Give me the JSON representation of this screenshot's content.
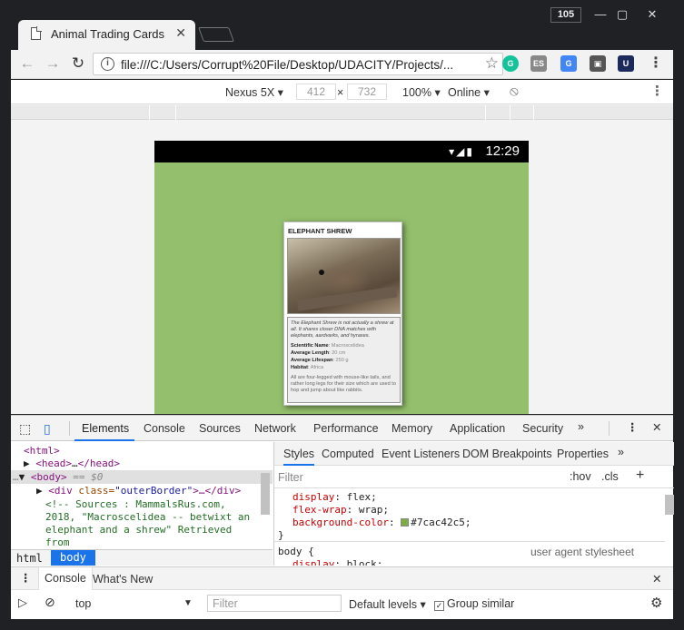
{
  "window": {
    "counter": "105",
    "minimize_icon": "minimize-icon",
    "maximize_icon": "maximize-icon",
    "close_icon": "close-icon"
  },
  "tab": {
    "title": "Animal Trading Cards",
    "close": "✕"
  },
  "toolbar": {
    "url": "file:///C:/Users/Corrupt%20File/Desktop/UDACITY/Projects/...",
    "info": "i"
  },
  "extensions": [
    {
      "name": "grammarly-icon",
      "label": "G",
      "color": "#15c39a"
    },
    {
      "name": "es-extension-icon",
      "label": "ES",
      "color": "#888888"
    },
    {
      "name": "google-translate-icon",
      "label": "G",
      "color": "#4285f4"
    },
    {
      "name": "clipboard-extension-icon",
      "label": "▣",
      "color": "#555555"
    },
    {
      "name": "udacity-extension-icon",
      "label": "U",
      "color": "#1c2a5b"
    }
  ],
  "device_toolbar": {
    "device": "Nexus 5X",
    "width": "412",
    "times": "×",
    "height": "732",
    "zoom": "100%",
    "network": "Online"
  },
  "phone": {
    "time": "12:29",
    "status_icons": "▾◢▮"
  },
  "card": {
    "name": "ELEPHANT SHREW",
    "description": "The Elephant Shrew is not actually a shrew at all. It shares closer DNA matches with elephants, aardvarks, and hyraxes.",
    "facts": [
      {
        "label": "Scientific Name",
        "value": "Macroscelidea"
      },
      {
        "label": "Average Length",
        "value": "20 cm"
      },
      {
        "label": "Average Lifespan",
        "value": "250 g"
      },
      {
        "label": "Habitat",
        "value": "Africa"
      }
    ],
    "more": "All are four-legged with mouse-like tails, and rather long legs for their size which are used to hop and jump about like rabbits."
  },
  "devtools": {
    "tabs": [
      "Elements",
      "Console",
      "Sources",
      "Network",
      "Performance",
      "Memory",
      "Application",
      "Security"
    ],
    "more": "»",
    "close": "✕",
    "dots": "⋮"
  },
  "elements": {
    "l1": "<html>",
    "l2_open": "<head>",
    "l2_mid": "…",
    "l2_close": "</head>",
    "l3_prefix": "…",
    "l3_tag": "<body>",
    "l3_suffix": " == $0",
    "l4_open": "<div ",
    "l4_attr": "class=",
    "l4_val": "\"outerBorder\"",
    "l4_rest": ">…</div>",
    "c1": "<!-- Sources : MammalsRus.com,",
    "c2": "2018, \"Macroscelidea -- betwixt an",
    "c3": "elephant and a shrew\" Retrieved",
    "c4": "from",
    "crumbs": [
      "html",
      "body"
    ]
  },
  "styles": {
    "tabs": [
      "Styles",
      "Computed",
      "Event Listeners",
      "DOM Breakpoints",
      "Properties"
    ],
    "filter_placeholder": "Filter",
    "hov": ":hov",
    ".cls": ".cls",
    "plus": "+",
    "r1_prop": "display",
    "r1_val": "flex;",
    "r2_prop": "flex-wrap",
    "r2_val": "wrap;",
    "r3_prop": "background-color",
    "r3_val": "#7cac42c5;",
    "brace": "}",
    "selector": "body {",
    "ua": "user agent stylesheet",
    "r4_prop": "display",
    "r4_val": "block;",
    "swatch_color": "#7cac42"
  },
  "drawer": {
    "tabs": [
      "Console",
      "What's New"
    ],
    "close": "✕",
    "context": "top",
    "filter_placeholder": "Filter",
    "levels": "Default levels",
    "group": "Group similar"
  }
}
